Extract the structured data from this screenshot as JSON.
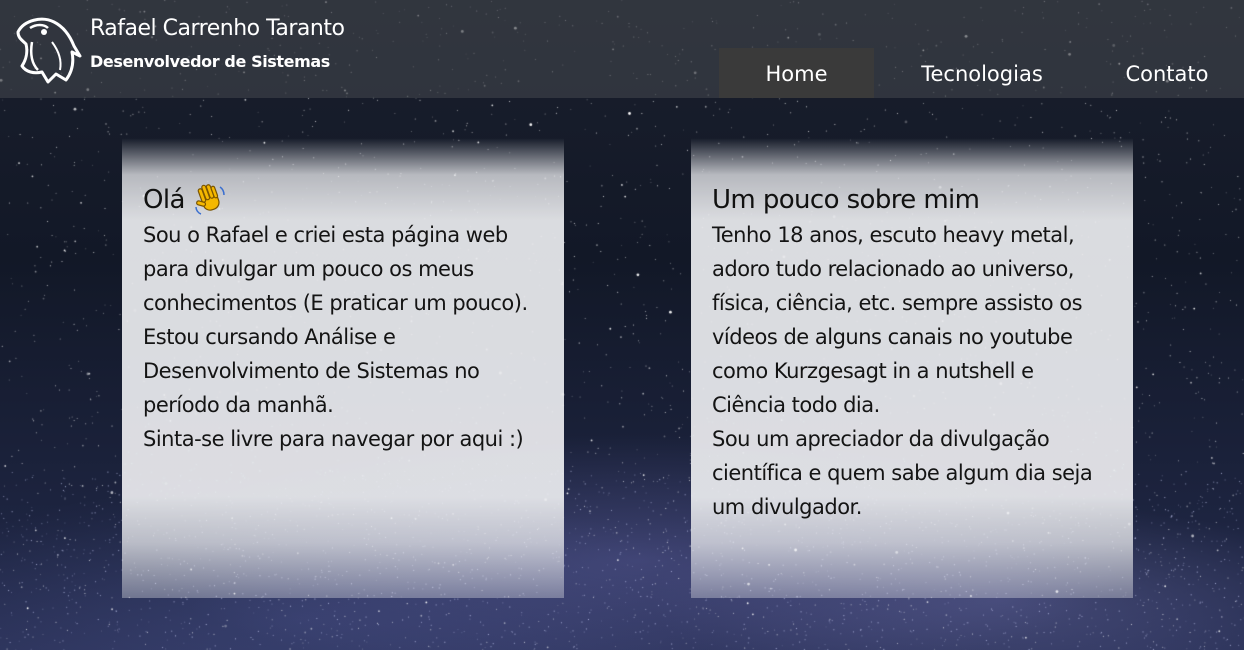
{
  "header": {
    "name": "Rafael Carrenho Taranto",
    "subtitle": "Desenvolvedor de Sistemas"
  },
  "nav": {
    "items": [
      {
        "label": "Home",
        "active": true
      },
      {
        "label": "Tecnologias",
        "active": false
      },
      {
        "label": "Contato",
        "active": false
      }
    ]
  },
  "cards": {
    "left": {
      "title": "Olá",
      "icon": "waving-hand-icon",
      "paragraphs": [
        "Sou o Rafael e criei esta página web para divulgar um pouco os meus conhecimentos (E praticar um pouco).",
        "Estou cursando Análise e Desenvolvimento de Sistemas no período da manhã.",
        "Sinta-se livre para navegar por aqui :)"
      ]
    },
    "right": {
      "title": "Um pouco sobre mim",
      "paragraphs": [
        "Tenho 18 anos, escuto heavy metal, adoro tudo relacionado ao universo, física, ciência, etc. sempre assisto os vídeos de alguns canais no youtube como Kurzgesagt in a nutshell e Ciência todo dia.",
        "Sou um apreciador da divulgação científica e quem sabe algum dia seja um divulgador."
      ]
    }
  },
  "colors": {
    "header_bg": "#46484e",
    "nav_active_bg": "#3a3a3a",
    "card_bg": "#ecedf0",
    "text_dark": "#141414",
    "text_light": "#ffffff"
  }
}
